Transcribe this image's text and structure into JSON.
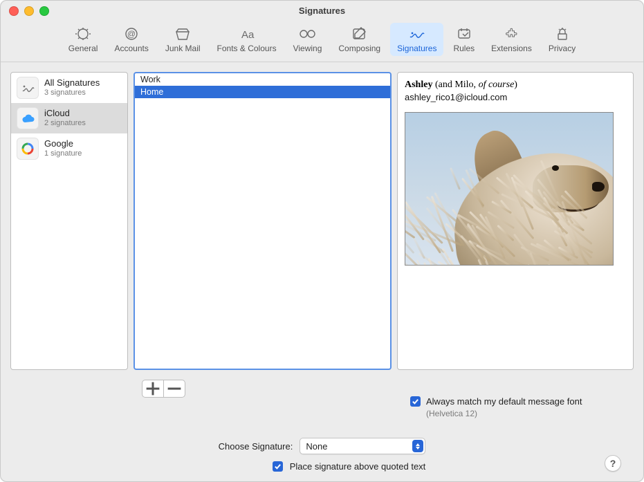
{
  "window": {
    "title": "Signatures"
  },
  "toolbar": {
    "items": [
      {
        "id": "general",
        "label": "General"
      },
      {
        "id": "accounts",
        "label": "Accounts"
      },
      {
        "id": "junk",
        "label": "Junk Mail"
      },
      {
        "id": "fonts",
        "label": "Fonts & Colours"
      },
      {
        "id": "viewing",
        "label": "Viewing"
      },
      {
        "id": "composing",
        "label": "Composing"
      },
      {
        "id": "signatures",
        "label": "Signatures",
        "selected": true
      },
      {
        "id": "rules",
        "label": "Rules"
      },
      {
        "id": "extensions",
        "label": "Extensions"
      },
      {
        "id": "privacy",
        "label": "Privacy"
      }
    ]
  },
  "accounts": [
    {
      "id": "all",
      "name": "All Signatures",
      "sub": "3 signatures",
      "icon": "signature",
      "selected": false
    },
    {
      "id": "icloud",
      "name": "iCloud",
      "sub": "2 signatures",
      "icon": "icloud",
      "selected": true
    },
    {
      "id": "google",
      "name": "Google",
      "sub": "1 signature",
      "icon": "google",
      "selected": false
    }
  ],
  "signatures": [
    {
      "name": "Work",
      "selected": false
    },
    {
      "name": "Home",
      "selected": true
    }
  ],
  "preview": {
    "name_bold": "Ashley",
    "name_paren": " (and Milo, ",
    "name_italic": "of course",
    "name_close": ")",
    "email": "ashley_rico1@icloud.com"
  },
  "buttons": {
    "add": "+",
    "remove": "−"
  },
  "options": {
    "match_font_label": "Always match my default message font",
    "match_font_hint": "(Helvetica 12)",
    "match_font_checked": true,
    "choose_label": "Choose Signature:",
    "choose_value": "None",
    "place_above_label": "Place signature above quoted text",
    "place_above_checked": true
  },
  "help": "?"
}
